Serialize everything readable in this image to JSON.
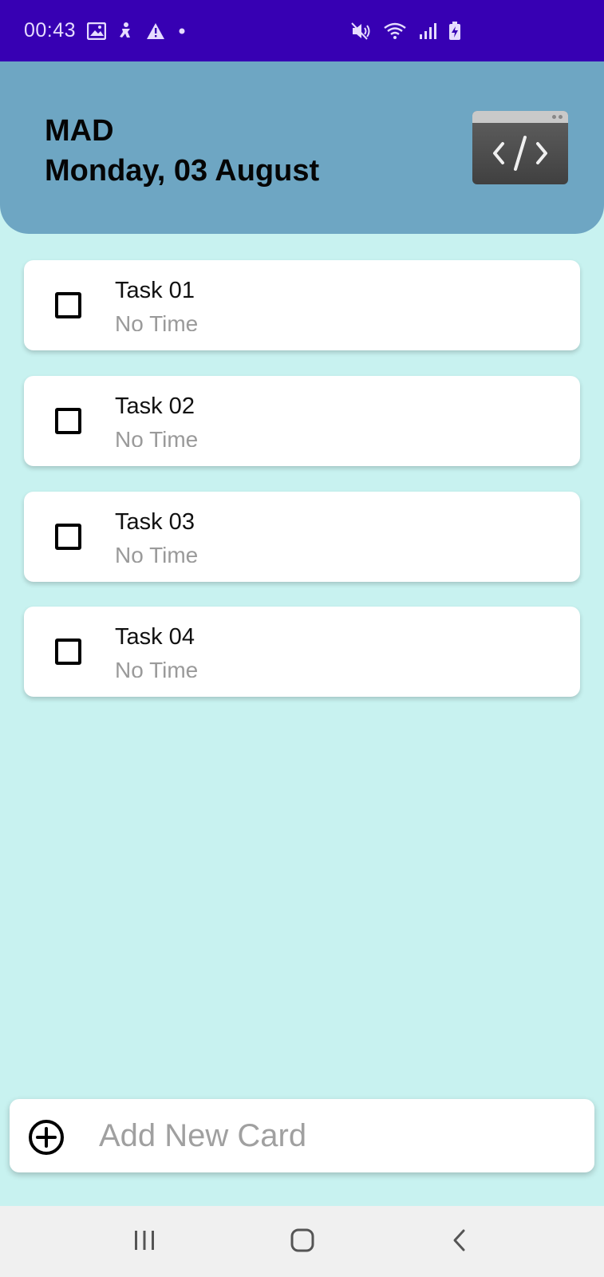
{
  "status_bar": {
    "time": "00:43",
    "left_icons": [
      "gallery-icon",
      "accessibility-icon",
      "warning-icon",
      "dot-icon"
    ],
    "right_icons": [
      "mute-icon",
      "wifi-icon",
      "signal-icon",
      "battery-charging-icon"
    ],
    "background": "#3700b3"
  },
  "header": {
    "title": "MAD",
    "date": "Monday, 03 August",
    "icon": "code-window-icon",
    "background": "#6ea6c3"
  },
  "tasks": [
    {
      "title": "Task 01",
      "time": "No Time",
      "checked": false
    },
    {
      "title": "Task 02",
      "time": "No Time",
      "checked": false
    },
    {
      "title": "Task 03",
      "time": "No Time",
      "checked": false
    },
    {
      "title": "Task 04",
      "time": "No Time",
      "checked": false
    }
  ],
  "add_card": {
    "placeholder": "Add New Card",
    "icon": "add-circle-icon"
  },
  "nav_bar": {
    "buttons": [
      "recents-icon",
      "home-icon",
      "back-icon"
    ]
  },
  "colors": {
    "page_background": "#c8f2f0",
    "card_background": "#ffffff"
  }
}
